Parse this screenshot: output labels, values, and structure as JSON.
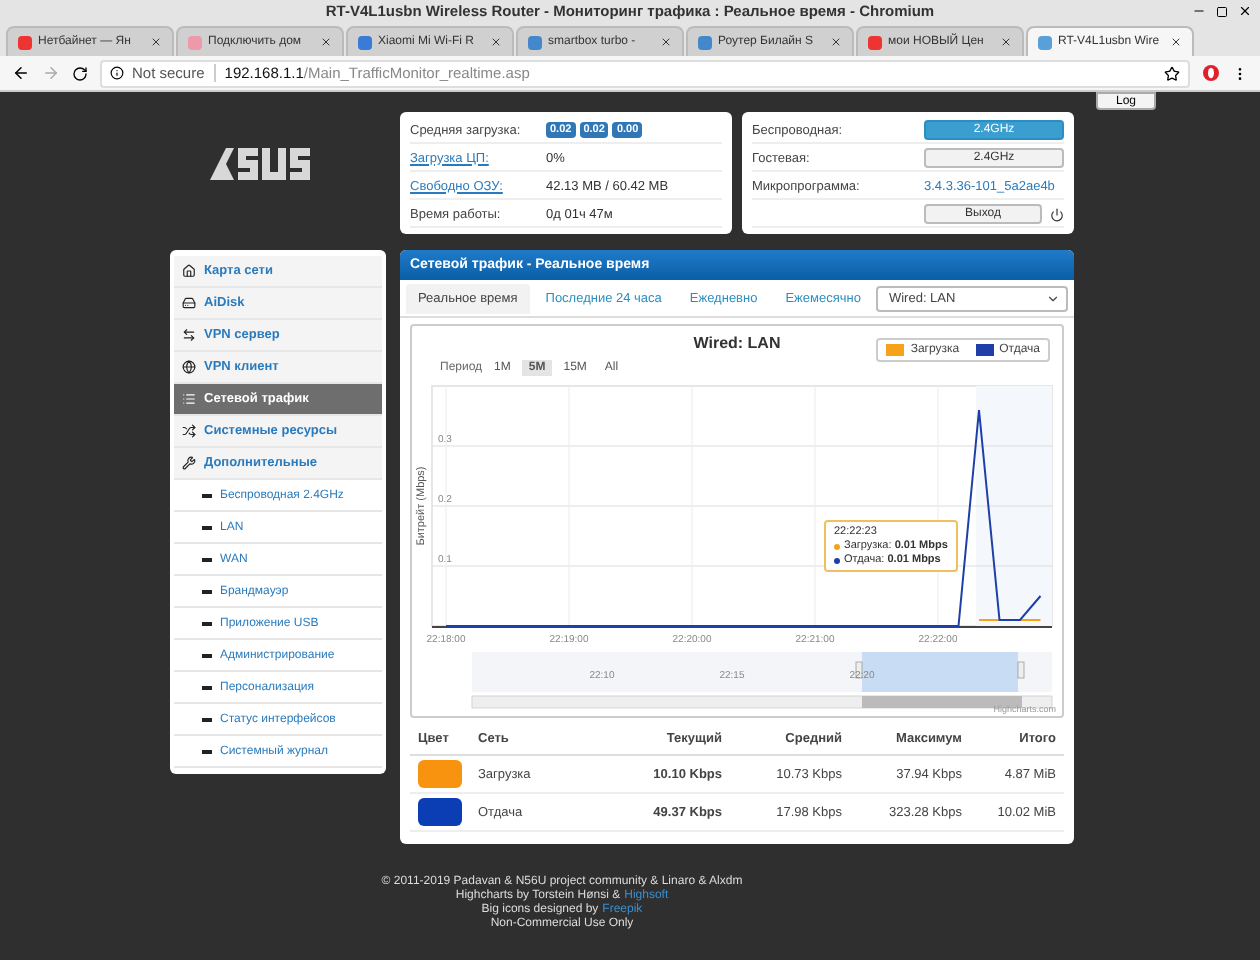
{
  "browser": {
    "window_title": "RT-V4L1usbn Wireless Router - Мониторинг трафика : Реальное время - Chromium",
    "tabs": [
      {
        "label": "Нетбайнет — Ян",
        "selected": false
      },
      {
        "label": "Подключить дом",
        "selected": false
      },
      {
        "label": "Xiaomi Mi Wi-Fi R",
        "selected": false
      },
      {
        "label": "smartbox turbo -",
        "selected": false
      },
      {
        "label": "Роутер Билайн S",
        "selected": false
      },
      {
        "label": "мои НОВЫЙ Цен",
        "selected": false
      },
      {
        "label": "RT-V4L1usbn Wire",
        "selected": true
      }
    ],
    "security": "Not secure",
    "host": "192.168.1.1",
    "path": "/Main_TrafficMonitor_realtime.asp"
  },
  "log_button": "Log",
  "status_left": [
    {
      "kind": "badges",
      "label": "Средняя загрузка:",
      "badges": [
        "0.02",
        "0.02",
        "0.00"
      ]
    },
    {
      "kind": "text",
      "label": "Загрузка ЦП:",
      "link": true,
      "value": "0%"
    },
    {
      "kind": "text",
      "label": "Свободно ОЗУ:",
      "link": true,
      "value": "42.13 MB / 60.42 MB"
    },
    {
      "kind": "text",
      "label": "Время работы:",
      "link": false,
      "value": "0д 01ч 47м"
    }
  ],
  "status_right": [
    {
      "kind": "button",
      "label": "Беспроводная:",
      "value": "2.4GHz",
      "selected": true
    },
    {
      "kind": "button",
      "label": "Гостевая:",
      "value": "2.4GHz",
      "selected": false
    },
    {
      "kind": "link",
      "label": "Микропрограмма:",
      "value": "3.4.3.36-101_5a2ae4b"
    },
    {
      "kind": "logout",
      "value": "Выход"
    }
  ],
  "sidebar": [
    {
      "label": "Карта сети",
      "selected": false
    },
    {
      "label": "AiDisk",
      "selected": false
    },
    {
      "label": "VPN сервер",
      "selected": false
    },
    {
      "label": "VPN клиент",
      "selected": false
    },
    {
      "label": "Сетевой трафик",
      "selected": true
    },
    {
      "label": "Системные ресурсы",
      "selected": false
    },
    {
      "label": "Дополнительные",
      "selected": false,
      "children": [
        {
          "label": "Беспроводная 2.4GHz"
        },
        {
          "label": "LAN"
        },
        {
          "label": "WAN"
        },
        {
          "label": "Брандмауэр"
        },
        {
          "label": "Приложение USB"
        },
        {
          "label": "Администрирование"
        },
        {
          "label": "Персонализация"
        },
        {
          "label": "Статус интерфейсов"
        },
        {
          "label": "Системный журнал"
        }
      ]
    }
  ],
  "main": {
    "title": "Сетевой трафик - Реальное время",
    "tabs": [
      {
        "label": "Реальное время",
        "selected": true
      },
      {
        "label": "Последние 24 часа",
        "selected": false
      },
      {
        "label": "Ежедневно",
        "selected": false
      },
      {
        "label": "Ежемесячно",
        "selected": false
      }
    ],
    "source_select": "Wired: LAN",
    "chart": {
      "period_label": "Период",
      "periods": [
        {
          "label": "1M",
          "selected": false
        },
        {
          "label": "5M",
          "selected": true
        },
        {
          "label": "15M",
          "selected": false
        },
        {
          "label": "All",
          "selected": false
        }
      ],
      "chart_data": {
        "type": "line",
        "title": "Wired: LAN",
        "ylabel": "Битрейт (Mbps)",
        "categories": [
          "22:18:00",
          null,
          null,
          null,
          null,
          null,
          "22:19:00",
          null,
          null,
          null,
          null,
          null,
          "22:20:00",
          null,
          null,
          null,
          null,
          null,
          "22:21:00",
          null,
          null,
          null,
          null,
          null,
          "22:22:00",
          null,
          null,
          null,
          null,
          null
        ],
        "series": [
          {
            "name": "Загрузка",
            "color": "#f7a21b",
            "values": [
              null,
              null,
              null,
              null,
              null,
              null,
              null,
              null,
              null,
              null,
              null,
              null,
              null,
              null,
              null,
              null,
              null,
              null,
              null,
              null,
              null,
              null,
              null,
              null,
              null,
              null,
              0.01,
              0.01,
              0.01,
              0.01
            ]
          },
          {
            "name": "Отдача",
            "color": "#1f3fa8",
            "values": [
              0,
              0,
              0,
              0,
              0,
              0,
              0,
              0,
              0,
              0,
              0,
              0,
              0,
              0,
              0,
              0,
              0,
              0,
              0,
              0,
              0,
              0,
              0,
              0,
              0,
              0,
              0.36,
              0.01,
              0.01,
              0.05
            ]
          }
        ],
        "ylim": [
          0,
          0.4
        ],
        "grid": true,
        "yticks": [
          0.1,
          0.2,
          0.3
        ]
      },
      "tooltip": {
        "time": "22:22:23",
        "rows": [
          "Загрузка: **0.01 Mbps**",
          "Отдача: **0.01 Mbps**"
        ]
      },
      "navigator_labels": [
        "22:10",
        "22:15",
        "22:20"
      ],
      "credit": "Highcharts.com"
    },
    "table": {
      "columns": [
        "Цвет",
        "Сеть",
        "Текущий",
        "Средний",
        "Максимум",
        "Итого"
      ],
      "rows": [
        {
          "color": "#f7930e",
          "name": "Загрузка",
          "current": "10.10 Kbps",
          "average": "10.73 Kbps",
          "max": "37.94 Kbps",
          "total": "4.87 MiB"
        },
        {
          "color": "#0b3db5",
          "name": "Отдача",
          "current": "49.37 Kbps",
          "average": "17.98 Kbps",
          "max": "323.28 Kbps",
          "total": "10.02 MiB"
        }
      ]
    }
  },
  "footer": [
    {
      "text": "© 2011-2019 Padavan & N56U project community & Linaro & Alxdm"
    },
    {
      "text": "Highcharts by Torstein Hønsi &",
      "link": "Highsoft"
    },
    {
      "text": "Big icons designed by",
      "link": "Freepik"
    },
    {
      "text": "Non-Commercial Use Only"
    }
  ]
}
